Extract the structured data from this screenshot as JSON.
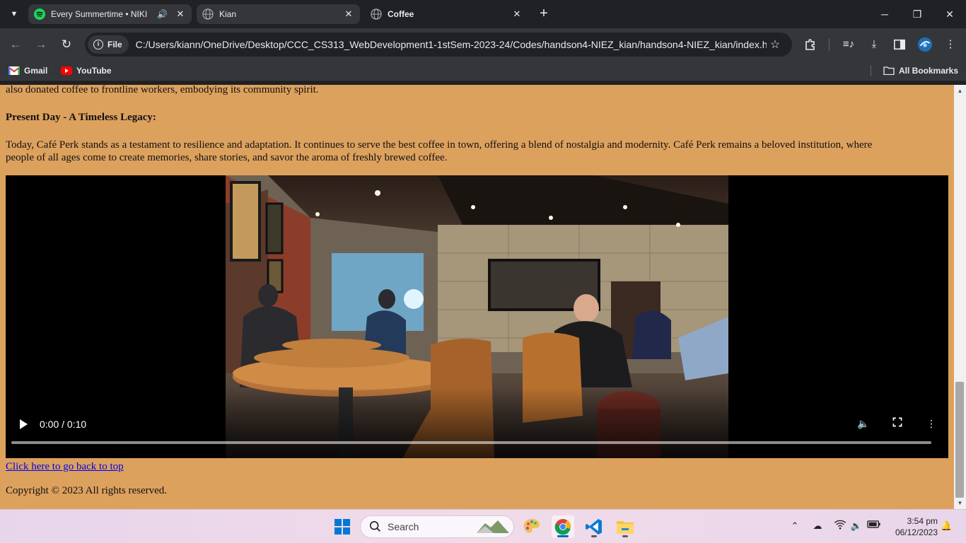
{
  "browser": {
    "tabs": [
      {
        "title": "Every Summertime • NIKI",
        "icon": "spotify-icon",
        "audio": true
      },
      {
        "title": "Kian",
        "icon": "globe-icon",
        "audio": false
      },
      {
        "title": "Coffee",
        "icon": "globe-icon",
        "audio": false,
        "active": true
      }
    ],
    "site_chip": "File",
    "url": "C:/Users/kiann/OneDrive/Desktop/CCC_CS313_WebDevelopment1-1stSem-2023-24/Codes/handson4-NIEZ_kian/handson4-NIEZ_kian/index.html",
    "bookmarks": [
      {
        "label": "Gmail",
        "icon": "gmail-icon"
      },
      {
        "label": "YouTube",
        "icon": "youtube-icon"
      }
    ],
    "all_bookmarks": "All Bookmarks"
  },
  "page": {
    "intro_tail": "also donated coffee to frontline workers, embodying its community spirit.",
    "heading": "Present Day - A Timeless Legacy:",
    "paragraph_line1": "Today, Café Perk stands as a testament to resilience and adaptation. It continues to serve the best coffee in town, offering a blend of nostalgia and modernity. Café Perk remains a beloved institution, where",
    "paragraph_line2": "people of all ages come to create memories, share stories, and savor the aroma of freshly brewed coffee.",
    "video": {
      "time": "0:00 / 0:10",
      "progress": 0
    },
    "back_link": "Click here to go back to top",
    "copyright": "Copyright © 2023 All rights reserved."
  },
  "taskbar": {
    "search_label": "Search",
    "time": "3:54 pm",
    "date": "06/12/2023"
  },
  "colors": {
    "page_bg": "#dda15e",
    "link": "#0000ee",
    "browser_dark": "#202124",
    "browser_toolbar": "#35363a"
  }
}
